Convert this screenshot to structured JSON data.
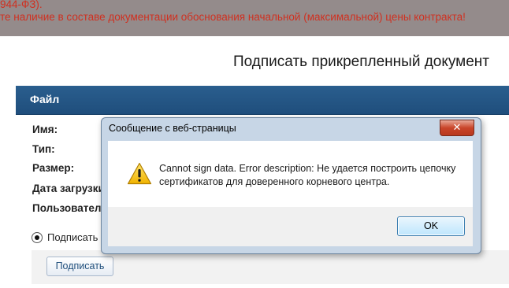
{
  "background": {
    "line1": "944-ФЗ).",
    "line2": "те наличие в составе документации обоснования начальной (максимальной) цены контракта!"
  },
  "panel": {
    "title": "Подписать прикрепленный документ",
    "file_header": "Файл",
    "labels": {
      "name": "Имя:",
      "type": "Тип:",
      "size": "Размер:",
      "date": "Дата загрузки",
      "user": "Пользователь"
    },
    "radio_label": "Подписать п",
    "sign_button": "Подписать"
  },
  "dialog": {
    "title": "Сообщение с веб-страницы",
    "close_glyph": "✕",
    "message": "Cannot sign data. Error description: Не удается построить цепочку сертификатов для доверенного корневого центра.",
    "ok_label": "OK",
    "icon": "warning-icon"
  }
}
